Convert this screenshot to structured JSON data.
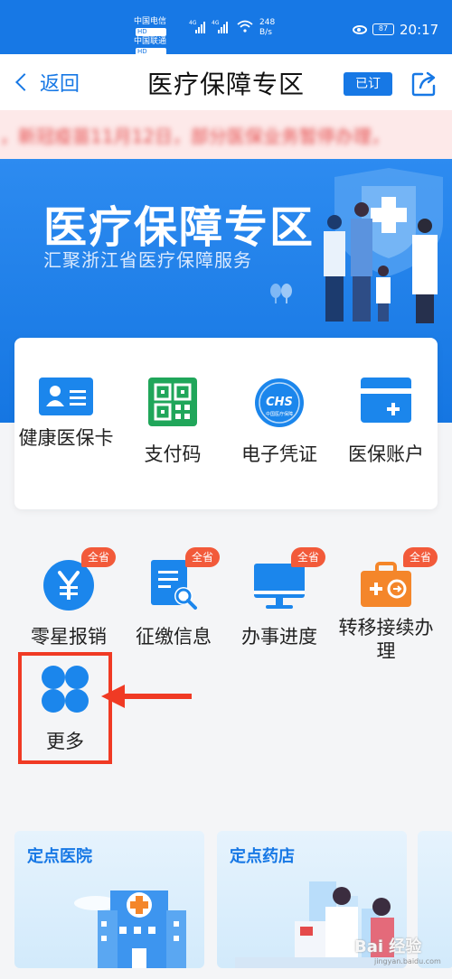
{
  "status_bar": {
    "carrier_1": "中国电信",
    "carrier_2": "中国联通",
    "hd": "HD",
    "net_1": "4G",
    "net_2": "4G",
    "speed_value": "248",
    "speed_unit": "B/s",
    "battery": "87",
    "time": "20:17"
  },
  "nav": {
    "back_label": "返回",
    "title": "医疗保障专区",
    "subscribed_label": "已订"
  },
  "notice": {
    "text": "，新冠疫苗11月12日，部分医保业务暂停办理，"
  },
  "banner": {
    "title": "医疗保障专区",
    "subtitle": "汇聚浙江省医疗保障服务"
  },
  "main_services": [
    {
      "label": "健康医保卡",
      "icon": "health-card-icon"
    },
    {
      "label": "支付码",
      "icon": "qr-code-icon"
    },
    {
      "label": "电子凭证",
      "icon": "chs-icon"
    },
    {
      "label": "医保账户",
      "icon": "wallet-icon"
    }
  ],
  "chs_logo_text": "CHS",
  "chs_logo_sub": "中国医疗保障",
  "services": [
    {
      "label": "零星报销",
      "badge": "全省",
      "icon": "yen-icon"
    },
    {
      "label": "征缴信息",
      "badge": "全省",
      "icon": "document-search-icon"
    },
    {
      "label": "办事进度",
      "badge": "全省",
      "icon": "monitor-icon"
    },
    {
      "label": "转移接续办理",
      "badge": "全省",
      "icon": "transfer-icon"
    },
    {
      "label": "更多",
      "icon": "more-icon"
    }
  ],
  "bottom_cards": [
    {
      "title": "定点医院"
    },
    {
      "title": "定点药店"
    }
  ],
  "watermark": {
    "text": "Bai 经验",
    "sub": "jingyan.baidu.com"
  },
  "colors": {
    "primary": "#1778e5",
    "badge": "#f25a3a",
    "highlight": "#f03a24"
  }
}
